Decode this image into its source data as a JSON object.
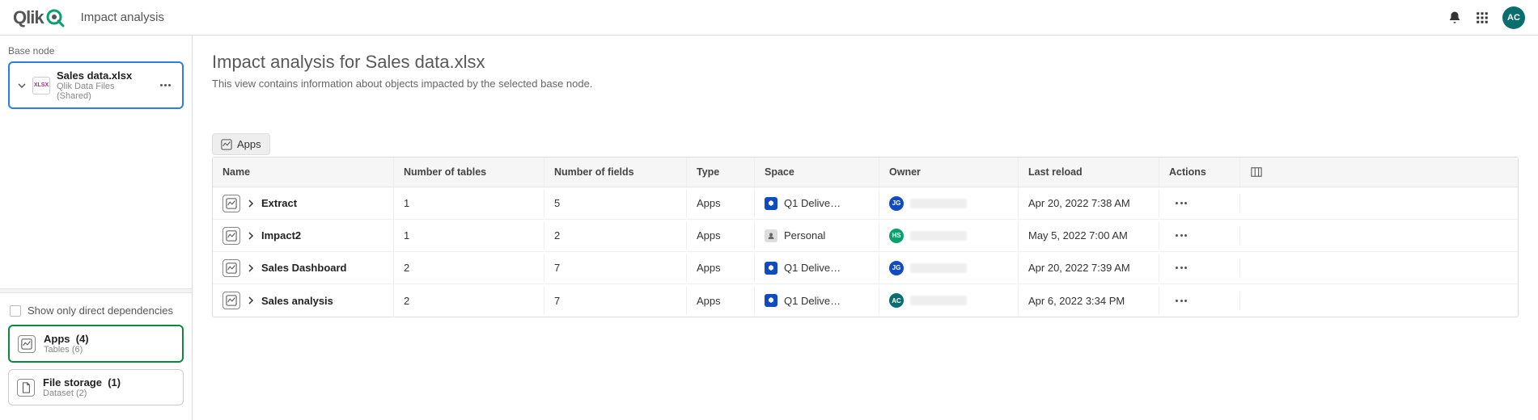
{
  "header": {
    "page_title": "Impact analysis",
    "user_initials": "AC"
  },
  "sidebar": {
    "base_label": "Base node",
    "base_node": {
      "name": "Sales data.xlsx",
      "source": "Qlik Data Files (Shared)",
      "icon_label": "XLSX"
    },
    "direct_deps_label": "Show only direct dependencies",
    "nav": [
      {
        "title": "Apps",
        "count": "(4)",
        "sub": "Tables (6)",
        "active": true
      },
      {
        "title": "File storage",
        "count": "(1)",
        "sub": "Dataset (2)",
        "active": false
      }
    ]
  },
  "main": {
    "title": "Impact analysis for Sales data.xlsx",
    "description": "This view contains information about objects impacted by the selected base node.",
    "tab_label": "Apps",
    "columns": {
      "name": "Name",
      "tables": "Number of tables",
      "fields": "Number of fields",
      "type": "Type",
      "space": "Space",
      "owner": "Owner",
      "reload": "Last reload",
      "actions": "Actions"
    },
    "rows": [
      {
        "name": "Extract",
        "tables": "1",
        "fields": "5",
        "type": "Apps",
        "space": "Q1 Delive…",
        "space_kind": "shared",
        "owner_initials": "JG",
        "owner_color": "#104bc1",
        "reload": "Apr 20, 2022 7:38 AM"
      },
      {
        "name": "Impact2",
        "tables": "1",
        "fields": "2",
        "type": "Apps",
        "space": "Personal",
        "space_kind": "personal",
        "owner_initials": "HS",
        "owner_color": "#0aa06e",
        "reload": "May 5, 2022 7:00 AM"
      },
      {
        "name": "Sales Dashboard",
        "tables": "2",
        "fields": "7",
        "type": "Apps",
        "space": "Q1 Delive…",
        "space_kind": "shared",
        "owner_initials": "JG",
        "owner_color": "#104bc1",
        "reload": "Apr 20, 2022 7:39 AM"
      },
      {
        "name": "Sales analysis",
        "tables": "2",
        "fields": "7",
        "type": "Apps",
        "space": "Q1 Delive…",
        "space_kind": "shared",
        "owner_initials": "AC",
        "owner_color": "#0b6e6e",
        "reload": "Apr 6, 2022 3:34 PM"
      }
    ]
  }
}
